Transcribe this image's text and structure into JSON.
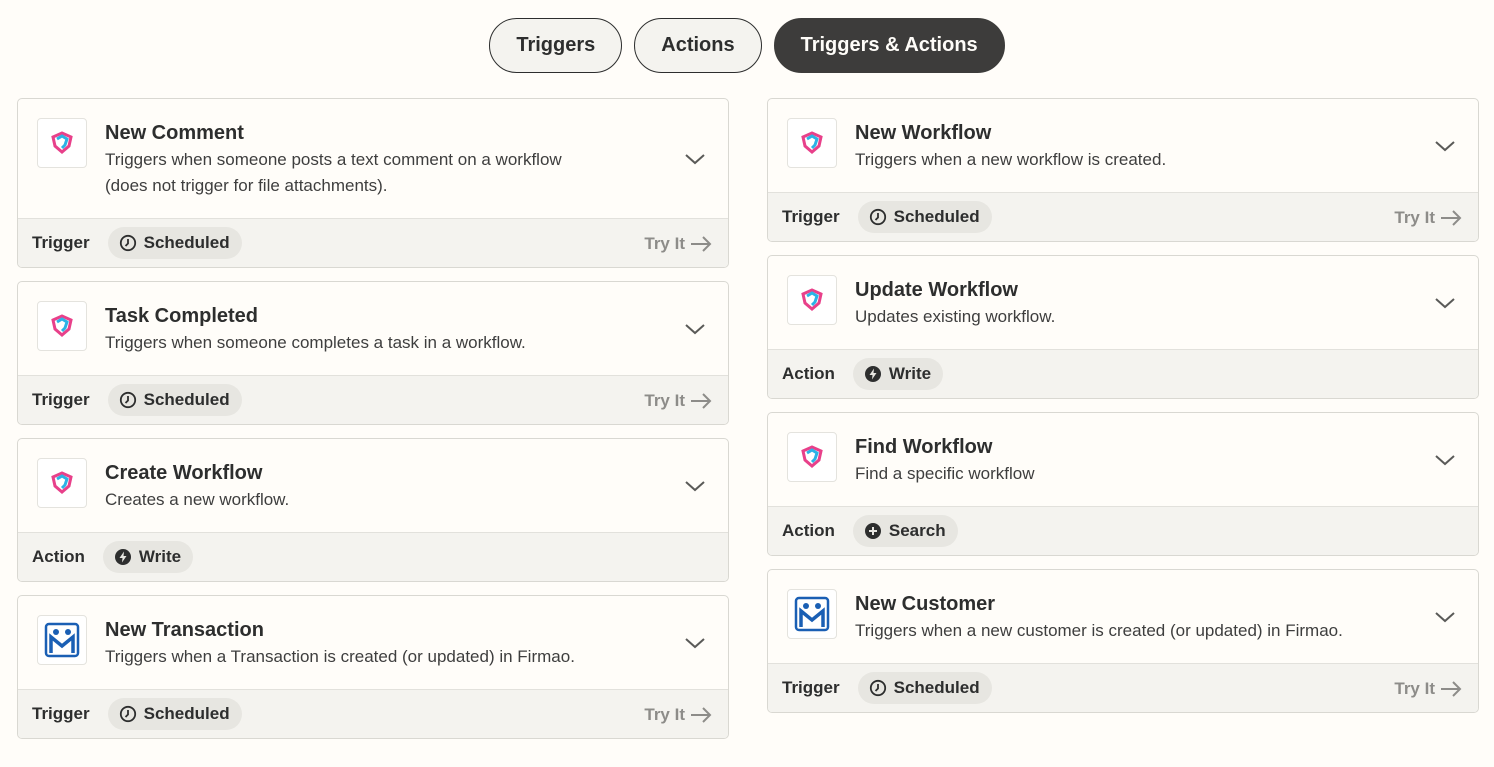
{
  "tabs": [
    {
      "label": "Triggers",
      "active": false
    },
    {
      "label": "Actions",
      "active": false
    },
    {
      "label": "Triggers & Actions",
      "active": true
    }
  ],
  "left_cards": [
    {
      "app": "workflow-app",
      "title": "New Comment",
      "desc_line1": "Triggers when someone posts a text comment on a workflow",
      "desc_line2": "(does not trigger for file attachments).",
      "kind": "Trigger",
      "badge": "Scheduled",
      "badge_icon": "clock-icon",
      "try_it": "Try It"
    },
    {
      "app": "workflow-app",
      "title": "Task Completed",
      "desc_line1": "Triggers when someone completes a task in a workflow.",
      "desc_line2": "",
      "kind": "Trigger",
      "badge": "Scheduled",
      "badge_icon": "clock-icon",
      "try_it": "Try It"
    },
    {
      "app": "workflow-app",
      "title": "Create Workflow",
      "desc_line1": "Creates a new workflow.",
      "desc_line2": "",
      "kind": "Action",
      "badge": "Write",
      "badge_icon": "bolt-icon",
      "try_it": ""
    },
    {
      "app": "firmao",
      "title": "New Transaction",
      "desc_line1": "Triggers when a Transaction is created (or updated) in Firmao.",
      "desc_line2": "",
      "kind": "Trigger",
      "badge": "Scheduled",
      "badge_icon": "clock-icon",
      "try_it": "Try It"
    }
  ],
  "right_cards": [
    {
      "app": "workflow-app",
      "title": "New Workflow",
      "desc_line1": "Triggers when a new workflow is created.",
      "desc_line2": "",
      "kind": "Trigger",
      "badge": "Scheduled",
      "badge_icon": "clock-icon",
      "try_it": "Try It"
    },
    {
      "app": "workflow-app",
      "title": "Update Workflow",
      "desc_line1": "Updates existing workflow.",
      "desc_line2": "",
      "kind": "Action",
      "badge": "Write",
      "badge_icon": "bolt-icon",
      "try_it": ""
    },
    {
      "app": "workflow-app",
      "title": "Find Workflow",
      "desc_line1": "Find a specific workflow",
      "desc_line2": "",
      "kind": "Action",
      "badge": "Search",
      "badge_icon": "plus-circle-icon",
      "try_it": ""
    },
    {
      "app": "firmao",
      "title": "New Customer",
      "desc_line1": "Triggers when a new customer is created (or updated) in Firmao.",
      "desc_line2": "",
      "kind": "Trigger",
      "badge": "Scheduled",
      "badge_icon": "clock-icon",
      "try_it": "Try It"
    }
  ],
  "colors": {
    "background": "#fffdf9",
    "active_tab": "#3d3c3b",
    "footer_bg": "#f4f3ef",
    "badge_bg": "#e7e6e1",
    "try_it_text": "#8d8c89"
  }
}
